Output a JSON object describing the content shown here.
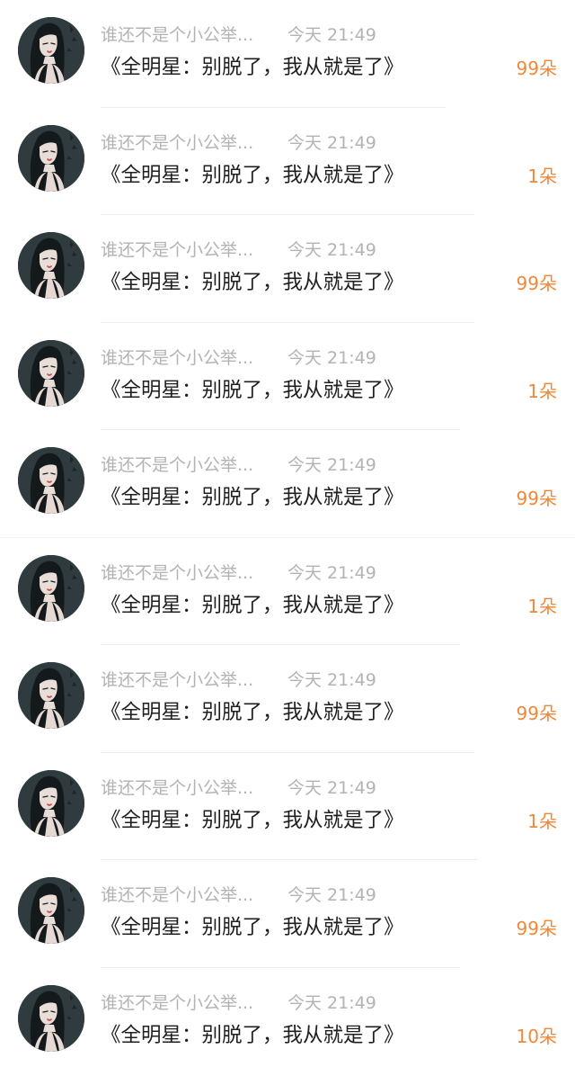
{
  "colors": {
    "background": "#ffffff",
    "meta_text": "#b3b3b3",
    "title_text": "#1f1f1f",
    "count_text": "#f0883a",
    "divider": "#eeeeee"
  },
  "items": [
    {
      "username": "谁还不是个小公举...",
      "time": "今天 21:49",
      "title": "《全明星：别脱了，我从就是了》",
      "count": "99朵",
      "avatar_icon": "avatar-girl-illustration"
    },
    {
      "username": "谁还不是个小公举...",
      "time": "今天 21:49",
      "title": "《全明星：别脱了，我从就是了》",
      "count": "1朵",
      "avatar_icon": "avatar-girl-illustration"
    },
    {
      "username": "谁还不是个小公举...",
      "time": "今天 21:49",
      "title": "《全明星：别脱了，我从就是了》",
      "count": "99朵",
      "avatar_icon": "avatar-girl-illustration"
    },
    {
      "username": "谁还不是个小公举...",
      "time": "今天 21:49",
      "title": "《全明星：别脱了，我从就是了》",
      "count": "1朵",
      "avatar_icon": "avatar-girl-illustration"
    },
    {
      "username": "谁还不是个小公举...",
      "time": "今天 21:49",
      "title": "《全明星：别脱了，我从就是了》",
      "count": "99朵",
      "avatar_icon": "avatar-girl-illustration"
    },
    {
      "username": "谁还不是个小公举...",
      "time": "今天 21:49",
      "title": "《全明星：别脱了，我从就是了》",
      "count": "1朵",
      "avatar_icon": "avatar-girl-illustration"
    },
    {
      "username": "谁还不是个小公举...",
      "time": "今天 21:49",
      "title": "《全明星：别脱了，我从就是了》",
      "count": "99朵",
      "avatar_icon": "avatar-girl-illustration"
    },
    {
      "username": "谁还不是个小公举...",
      "time": "今天 21:49",
      "title": "《全明星：别脱了，我从就是了》",
      "count": "1朵",
      "avatar_icon": "avatar-girl-illustration"
    },
    {
      "username": "谁还不是个小公举...",
      "time": "今天 21:49",
      "title": "《全明星：别脱了，我从就是了》",
      "count": "99朵",
      "avatar_icon": "avatar-girl-illustration"
    },
    {
      "username": "谁还不是个小公举...",
      "time": "今天 21:49",
      "title": "《全明星：别脱了，我从就是了》",
      "count": "10朵",
      "avatar_icon": "avatar-girl-illustration"
    }
  ]
}
